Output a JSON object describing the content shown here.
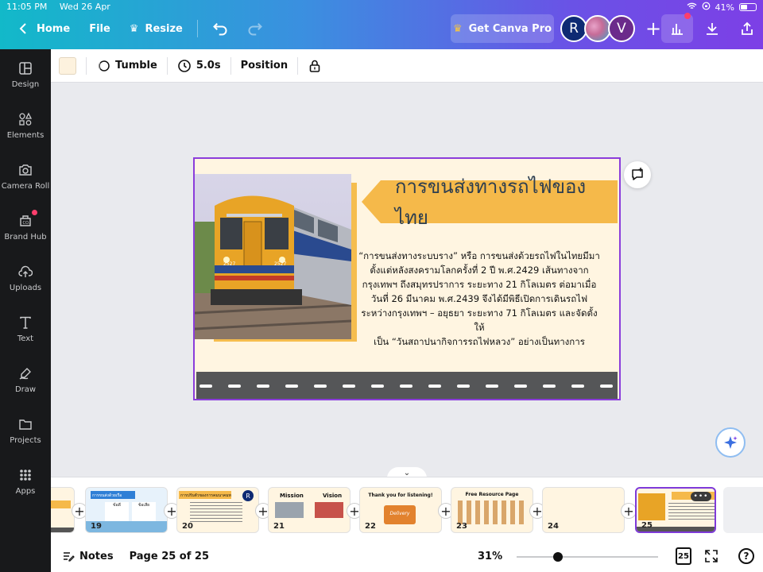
{
  "status_bar": {
    "time": "11:05 PM",
    "date": "Wed 26 Apr",
    "battery": "41%"
  },
  "header": {
    "home_label": "Home",
    "file_label": "File",
    "resize_label": "Resize",
    "pro_label": "Get Canva Pro",
    "avatar_r": "R",
    "avatar_v": "V",
    "add_label": "+"
  },
  "sidebar": {
    "items": [
      {
        "label": "Design",
        "icon": "layout-icon"
      },
      {
        "label": "Elements",
        "icon": "shapes-icon"
      },
      {
        "label": "Camera Roll",
        "icon": "camera-icon"
      },
      {
        "label": "Brand Hub",
        "icon": "brand-icon"
      },
      {
        "label": "Uploads",
        "icon": "cloud-upload-icon"
      },
      {
        "label": "Text",
        "icon": "text-icon"
      },
      {
        "label": "Draw",
        "icon": "draw-icon"
      },
      {
        "label": "Projects",
        "icon": "folder-icon"
      },
      {
        "label": "Apps",
        "icon": "apps-icon"
      }
    ]
  },
  "toolbar": {
    "background_color": "#fdf2de",
    "animation_label": "Tumble",
    "duration_label": "5.0s",
    "position_label": "Position"
  },
  "slide": {
    "title": "การขนส่งทางรถไฟของไทย",
    "body_lines": [
      "“การขนส่งทางระบบราง” หรือ การขนส่งด้วยรถไฟในไทยมีมา",
      "ตั้งแต่หลังสงครามโลกครั้งที่ 2 ปี พ.ศ.2429 เส้นทางจาก",
      "กรุงเทพฯ ถึงสมุทรปราการ ระยะทาง 21 กิโลเมตร ต่อมาเมื่อ",
      "วันที่ 26 มีนาคม พ.ศ.2439 จึงได้มีพิธีเปิดการเดินรถไฟ",
      "ระหว่างกรุงเทพฯ – อยุธยา ระยะทาง 71 กิโลเมตร และจัดตั้งให้",
      "เป็น “วันสถาปนากิจการรถไฟหลวง” อย่างเป็นทางการ"
    ],
    "train_number": "2527",
    "colors": {
      "background": "#fff5e1",
      "accent": "#f5b94a",
      "road": "#555658",
      "selection": "#8b3ddb"
    }
  },
  "filmstrip": {
    "thumbs": [
      {
        "num": "19",
        "caption": "การขนส่งด้วยเรือ",
        "sub_a": "ข้อดี",
        "sub_b": "ข้อเสีย"
      },
      {
        "num": "20",
        "caption": "การปรับตัวของการคมนาคมทางบก",
        "badge": "R"
      },
      {
        "num": "21",
        "caption_a": "Mission",
        "caption_b": "Vision"
      },
      {
        "num": "22",
        "caption": "Thank you for listening!",
        "sticker": "Delivery"
      },
      {
        "num": "23",
        "caption": "Free Resource Page"
      },
      {
        "num": "24"
      },
      {
        "num": "25",
        "more": "•••"
      }
    ]
  },
  "bottom": {
    "notes_label": "Notes",
    "page_label": "Page 25 of 25",
    "zoom": "31%",
    "zoom_fraction": 0.29,
    "page_count": "25",
    "help": "?"
  }
}
